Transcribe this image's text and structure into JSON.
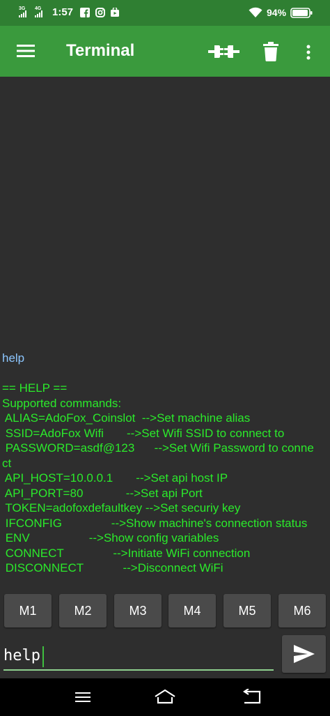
{
  "status_bar": {
    "net1": "3G",
    "net2": "4G",
    "time": "1:57",
    "battery": "94%",
    "icons": [
      "signal-icon",
      "signal-icon",
      "facebook-icon",
      "instagram-icon",
      "store-icon",
      "wifi-icon",
      "battery-icon"
    ]
  },
  "app_bar": {
    "title": "Terminal",
    "icons": [
      "menu-icon",
      "connect-icon",
      "delete-icon",
      "more-icon"
    ]
  },
  "terminal": {
    "lines": [
      {
        "text": "help",
        "kind": "cmd"
      },
      {
        "text": "",
        "kind": "out"
      },
      {
        "text": "== HELP ==",
        "kind": "out"
      },
      {
        "text": "Supported commands:",
        "kind": "out"
      },
      {
        "text": " ALIAS=AdoFox_Coinslot  -->Set machine alias",
        "kind": "out"
      },
      {
        "text": " SSID=AdoFox Wifi       -->Set Wifi SSID to connect to",
        "kind": "out"
      },
      {
        "text": " PASSWORD=asdf@123      -->Set Wifi Password to conne",
        "kind": "out"
      },
      {
        "text": "ct",
        "kind": "out"
      },
      {
        "text": " API_HOST=10.0.0.1       -->Set api host IP",
        "kind": "out"
      },
      {
        "text": " API_PORT=80             -->Set api Port",
        "kind": "out"
      },
      {
        "text": " TOKEN=adofoxdefaultkey -->Set securiy key",
        "kind": "out"
      },
      {
        "text": " IFCONFIG               -->Show machine's connection status",
        "kind": "out"
      },
      {
        "text": " ENV                  -->Show config variables",
        "kind": "out"
      },
      {
        "text": " CONNECT               -->Initiate WiFi connection",
        "kind": "out"
      },
      {
        "text": " DISCONNECT            -->Disconnect WiFi",
        "kind": "out"
      }
    ],
    "colors": {
      "command": "#8cc6ff",
      "output": "#2bea2b"
    }
  },
  "macros": [
    "M1",
    "M2",
    "M3",
    "M4",
    "M5",
    "M6"
  ],
  "input": {
    "value": "help",
    "send_icon": "send-icon"
  },
  "nav_bar": {
    "icons": [
      "recents-icon",
      "home-icon",
      "back-icon"
    ]
  },
  "colors": {
    "app_bar": "#3a9a3d",
    "status_bar": "#2f7f32",
    "background": "#2e2e2e",
    "button": "#4a4a4a"
  }
}
